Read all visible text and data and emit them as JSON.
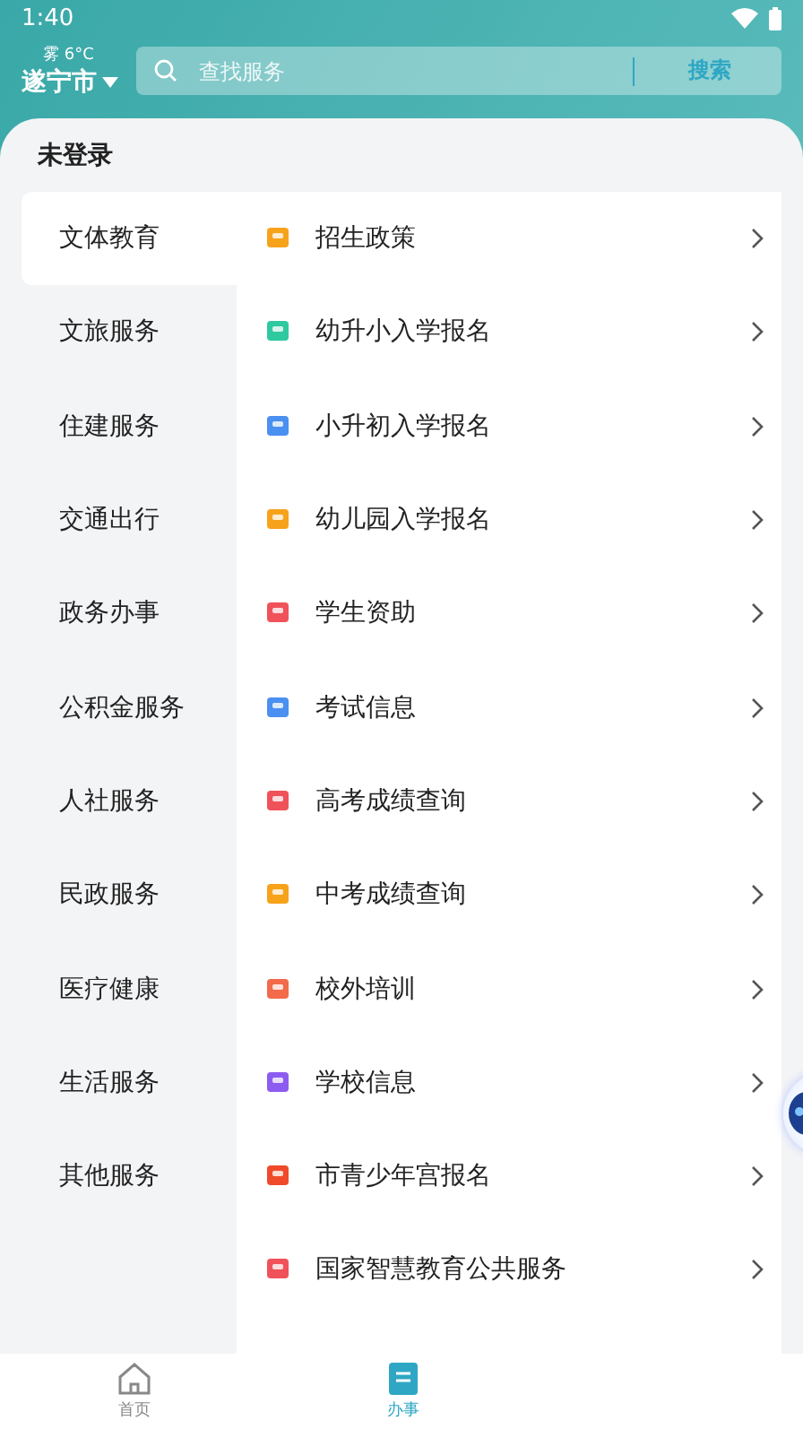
{
  "status_bar": {
    "time": "1:40"
  },
  "header": {
    "weather": "雾 6°C",
    "city": "遂宁市",
    "search": {
      "placeholder": "查找服务",
      "button": "搜索"
    }
  },
  "login_status": "未登录",
  "categories": [
    {
      "label": "文体教育",
      "selected": true
    },
    {
      "label": "文旅服务",
      "selected": false
    },
    {
      "label": "住建服务",
      "selected": false
    },
    {
      "label": "交通出行",
      "selected": false
    },
    {
      "label": "政务办事",
      "selected": false
    },
    {
      "label": "公积金服务",
      "selected": false
    },
    {
      "label": "人社服务",
      "selected": false
    },
    {
      "label": "民政服务",
      "selected": false
    },
    {
      "label": "医疗健康",
      "selected": false
    },
    {
      "label": "生活服务",
      "selected": false
    },
    {
      "label": "其他服务",
      "selected": false
    }
  ],
  "services": [
    {
      "label": "招生政策"
    },
    {
      "label": "幼升小入学报名"
    },
    {
      "label": "小升初入学报名"
    },
    {
      "label": "幼儿园入学报名"
    },
    {
      "label": "学生资助"
    },
    {
      "label": "考试信息"
    },
    {
      "label": "高考成绩查询"
    },
    {
      "label": "中考成绩查询"
    },
    {
      "label": "校外培训"
    },
    {
      "label": "学校信息"
    },
    {
      "label": "市青少年宫报名"
    },
    {
      "label": "国家智慧教育公共服务"
    }
  ],
  "bottom_nav": [
    {
      "label": "首页",
      "selected": false
    },
    {
      "label": "办事",
      "selected": true
    }
  ]
}
